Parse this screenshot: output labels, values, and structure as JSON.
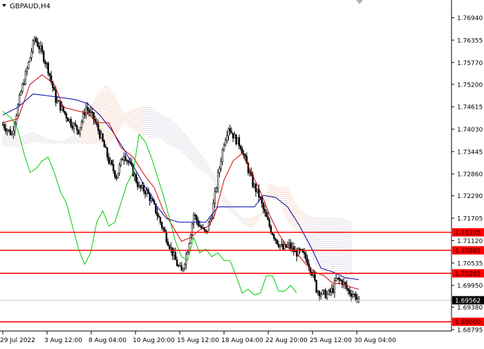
{
  "header": {
    "symbol": "GBPAUD,H4"
  },
  "colors": {
    "tenkan": "#cc0000",
    "kijun": "#0000aa",
    "chikou": "#00cc00",
    "cloud_bear": "#e08050",
    "cloud_bull": "#a090b0",
    "level": "#ff0000",
    "label_bg": "#ff0000",
    "current_bg": "#000000"
  },
  "chart_data": {
    "type": "candlestick",
    "indicator": "Ichimoku Kinko Hyo",
    "ylim": [
      1.68795,
      1.7715
    ],
    "y_ticks": [
      "1.76940",
      "1.76355",
      "1.75770",
      "1.75200",
      "1.74615",
      "1.74030",
      "1.73445",
      "1.72860",
      "1.72290",
      "1.71705",
      "1.71120",
      "1.70535",
      "1.69950",
      "1.69380",
      "1.68795"
    ],
    "x_ticks": [
      "29 Jul 2022",
      "3 Aug 12:00",
      "8 Aug 04:00",
      "10 Aug 20:00",
      "15 Aug 12:00",
      "18 Aug 04:00",
      "22 Aug 20:00",
      "25 Aug 12:00",
      "30 Aug 04:00"
    ],
    "levels": [
      {
        "value": 1.71335,
        "label": "1.71335"
      },
      {
        "value": 1.70865,
        "label": "1.70865"
      },
      {
        "value": 1.70265,
        "label": "1.70265"
      },
      {
        "value": 1.69,
        "label": "1.69000"
      }
    ],
    "current_price": {
      "value": 1.69562,
      "label": "1.69562"
    },
    "close_path": [
      [
        0,
        1.7415
      ],
      [
        6,
        1.739
      ],
      [
        12,
        1.75
      ],
      [
        17,
        1.7575
      ],
      [
        21,
        1.764
      ],
      [
        25,
        1.761
      ],
      [
        30,
        1.756
      ],
      [
        35,
        1.748
      ],
      [
        40,
        1.745
      ],
      [
        45,
        1.742
      ],
      [
        50,
        1.74
      ],
      [
        55,
        1.746
      ],
      [
        60,
        1.743
      ],
      [
        65,
        1.738
      ],
      [
        70,
        1.732
      ],
      [
        75,
        1.728
      ],
      [
        80,
        1.734
      ],
      [
        85,
        1.73
      ],
      [
        90,
        1.725
      ],
      [
        95,
        1.724
      ],
      [
        100,
        1.72
      ],
      [
        105,
        1.715
      ],
      [
        110,
        1.71
      ],
      [
        115,
        1.705
      ],
      [
        118,
        1.703
      ],
      [
        122,
        1.709
      ],
      [
        126,
        1.718
      ],
      [
        130,
        1.715
      ],
      [
        134,
        1.713
      ],
      [
        138,
        1.718
      ],
      [
        142,
        1.728
      ],
      [
        146,
        1.737
      ],
      [
        149,
        1.741
      ],
      [
        153,
        1.738
      ],
      [
        157,
        1.736
      ],
      [
        161,
        1.731
      ],
      [
        165,
        1.726
      ],
      [
        169,
        1.723
      ],
      [
        173,
        1.718
      ],
      [
        177,
        1.714
      ],
      [
        181,
        1.711
      ],
      [
        185,
        1.709
      ],
      [
        189,
        1.71
      ],
      [
        193,
        1.708
      ],
      [
        197,
        1.708
      ],
      [
        201,
        1.706
      ],
      [
        205,
        1.702
      ],
      [
        207,
        1.6985
      ],
      [
        210,
        1.6975
      ],
      [
        214,
        1.697
      ],
      [
        218,
        1.6985
      ],
      [
        220,
        1.701
      ],
      [
        224,
        1.7005
      ],
      [
        228,
        1.698
      ],
      [
        232,
        1.697
      ],
      [
        235,
        1.6956
      ]
    ],
    "tenkan_path": [
      [
        0,
        1.742
      ],
      [
        10,
        1.743
      ],
      [
        18,
        1.752
      ],
      [
        26,
        1.7545
      ],
      [
        34,
        1.752
      ],
      [
        40,
        1.746
      ],
      [
        50,
        1.745
      ],
      [
        56,
        1.7445
      ],
      [
        62,
        1.742
      ],
      [
        70,
        1.742
      ],
      [
        78,
        1.7355
      ],
      [
        86,
        1.733
      ],
      [
        94,
        1.728
      ],
      [
        100,
        1.725
      ],
      [
        106,
        1.719
      ],
      [
        112,
        1.715
      ],
      [
        118,
        1.711
      ],
      [
        124,
        1.712
      ],
      [
        130,
        1.714
      ],
      [
        136,
        1.715
      ],
      [
        140,
        1.718
      ],
      [
        146,
        1.727
      ],
      [
        152,
        1.732
      ],
      [
        158,
        1.734
      ],
      [
        164,
        1.729
      ],
      [
        170,
        1.724
      ],
      [
        176,
        1.718
      ],
      [
        182,
        1.713
      ],
      [
        188,
        1.7095
      ],
      [
        194,
        1.708
      ],
      [
        200,
        1.705
      ],
      [
        206,
        1.703
      ],
      [
        212,
        1.702
      ],
      [
        218,
        1.7
      ],
      [
        224,
        1.7
      ],
      [
        230,
        1.699
      ],
      [
        235,
        1.6985
      ]
    ],
    "kijun_path": [
      [
        0,
        1.744
      ],
      [
        10,
        1.746
      ],
      [
        20,
        1.7495
      ],
      [
        30,
        1.749
      ],
      [
        40,
        1.7485
      ],
      [
        48,
        1.748
      ],
      [
        56,
        1.747
      ],
      [
        64,
        1.744
      ],
      [
        72,
        1.74
      ],
      [
        80,
        1.735
      ],
      [
        90,
        1.728
      ],
      [
        100,
        1.721
      ],
      [
        108,
        1.717
      ],
      [
        116,
        1.716
      ],
      [
        126,
        1.716
      ],
      [
        134,
        1.716
      ],
      [
        142,
        1.72
      ],
      [
        150,
        1.72
      ],
      [
        158,
        1.72
      ],
      [
        166,
        1.72
      ],
      [
        172,
        1.723
      ],
      [
        180,
        1.7225
      ],
      [
        188,
        1.72
      ],
      [
        196,
        1.715
      ],
      [
        204,
        1.709
      ],
      [
        210,
        1.704
      ],
      [
        218,
        1.703
      ],
      [
        226,
        1.7015
      ],
      [
        235,
        1.701
      ]
    ],
    "chikou_path": [
      [
        0,
        1.745
      ],
      [
        6,
        1.743
      ],
      [
        10,
        1.74
      ],
      [
        14,
        1.734
      ],
      [
        18,
        1.729
      ],
      [
        22,
        1.73
      ],
      [
        26,
        1.732
      ],
      [
        30,
        1.733
      ],
      [
        34,
        1.729
      ],
      [
        38,
        1.724
      ],
      [
        42,
        1.721
      ],
      [
        46,
        1.715
      ],
      [
        50,
        1.709
      ],
      [
        54,
        1.705
      ],
      [
        58,
        1.708
      ],
      [
        62,
        1.716
      ],
      [
        66,
        1.719
      ],
      [
        70,
        1.715
      ],
      [
        74,
        1.716
      ],
      [
        78,
        1.721
      ],
      [
        82,
        1.726
      ],
      [
        86,
        1.729
      ],
      [
        90,
        1.739
      ],
      [
        94,
        1.737
      ],
      [
        98,
        1.733
      ],
      [
        102,
        1.728
      ],
      [
        106,
        1.723
      ],
      [
        110,
        1.717
      ],
      [
        114,
        1.711
      ],
      [
        118,
        1.707
      ],
      [
        122,
        1.706
      ],
      [
        126,
        1.712
      ],
      [
        130,
        1.708
      ],
      [
        134,
        1.709
      ],
      [
        138,
        1.707
      ],
      [
        142,
        1.708
      ],
      [
        146,
        1.706
      ],
      [
        150,
        1.706
      ],
      [
        154,
        1.702
      ],
      [
        158,
        1.6975
      ],
      [
        162,
        1.6985
      ],
      [
        166,
        1.697
      ],
      [
        170,
        1.6975
      ],
      [
        174,
        1.702
      ],
      [
        178,
        1.702
      ],
      [
        182,
        1.698
      ],
      [
        186,
        1.698
      ],
      [
        190,
        1.6995
      ],
      [
        194,
        1.6975
      ]
    ],
    "cloud_path": [
      [
        0,
        1.739,
        1.736
      ],
      [
        10,
        1.738,
        1.7355
      ],
      [
        20,
        1.7395,
        1.737
      ],
      [
        30,
        1.7375,
        1.7365
      ],
      [
        40,
        1.737,
        1.7365
      ],
      [
        50,
        1.7395,
        1.7365
      ],
      [
        56,
        1.744,
        1.7365
      ],
      [
        62,
        1.749,
        1.7365
      ],
      [
        68,
        1.752,
        1.736
      ],
      [
        74,
        1.749,
        1.738
      ],
      [
        80,
        1.744,
        1.742
      ],
      [
        86,
        1.7455,
        1.74
      ],
      [
        92,
        1.746,
        1.739
      ],
      [
        98,
        1.746,
        1.738
      ],
      [
        104,
        1.744,
        1.738
      ],
      [
        110,
        1.743,
        1.736
      ],
      [
        116,
        1.741,
        1.735
      ],
      [
        122,
        1.738,
        1.733
      ],
      [
        128,
        1.735,
        1.73
      ],
      [
        134,
        1.732,
        1.729
      ],
      [
        140,
        1.728,
        1.726
      ],
      [
        146,
        1.723,
        1.72
      ],
      [
        152,
        1.72,
        1.718
      ],
      [
        158,
        1.717,
        1.716
      ],
      [
        164,
        1.717,
        1.714
      ],
      [
        170,
        1.718,
        1.717
      ],
      [
        176,
        1.726,
        1.722
      ],
      [
        182,
        1.725,
        1.722
      ],
      [
        188,
        1.725,
        1.716
      ],
      [
        194,
        1.72,
        1.714
      ],
      [
        200,
        1.718,
        1.711
      ],
      [
        206,
        1.717,
        1.705
      ],
      [
        212,
        1.717,
        1.702
      ],
      [
        218,
        1.717,
        1.7
      ],
      [
        224,
        1.717,
        1.7
      ],
      [
        230,
        1.716,
        1.7
      ]
    ]
  }
}
